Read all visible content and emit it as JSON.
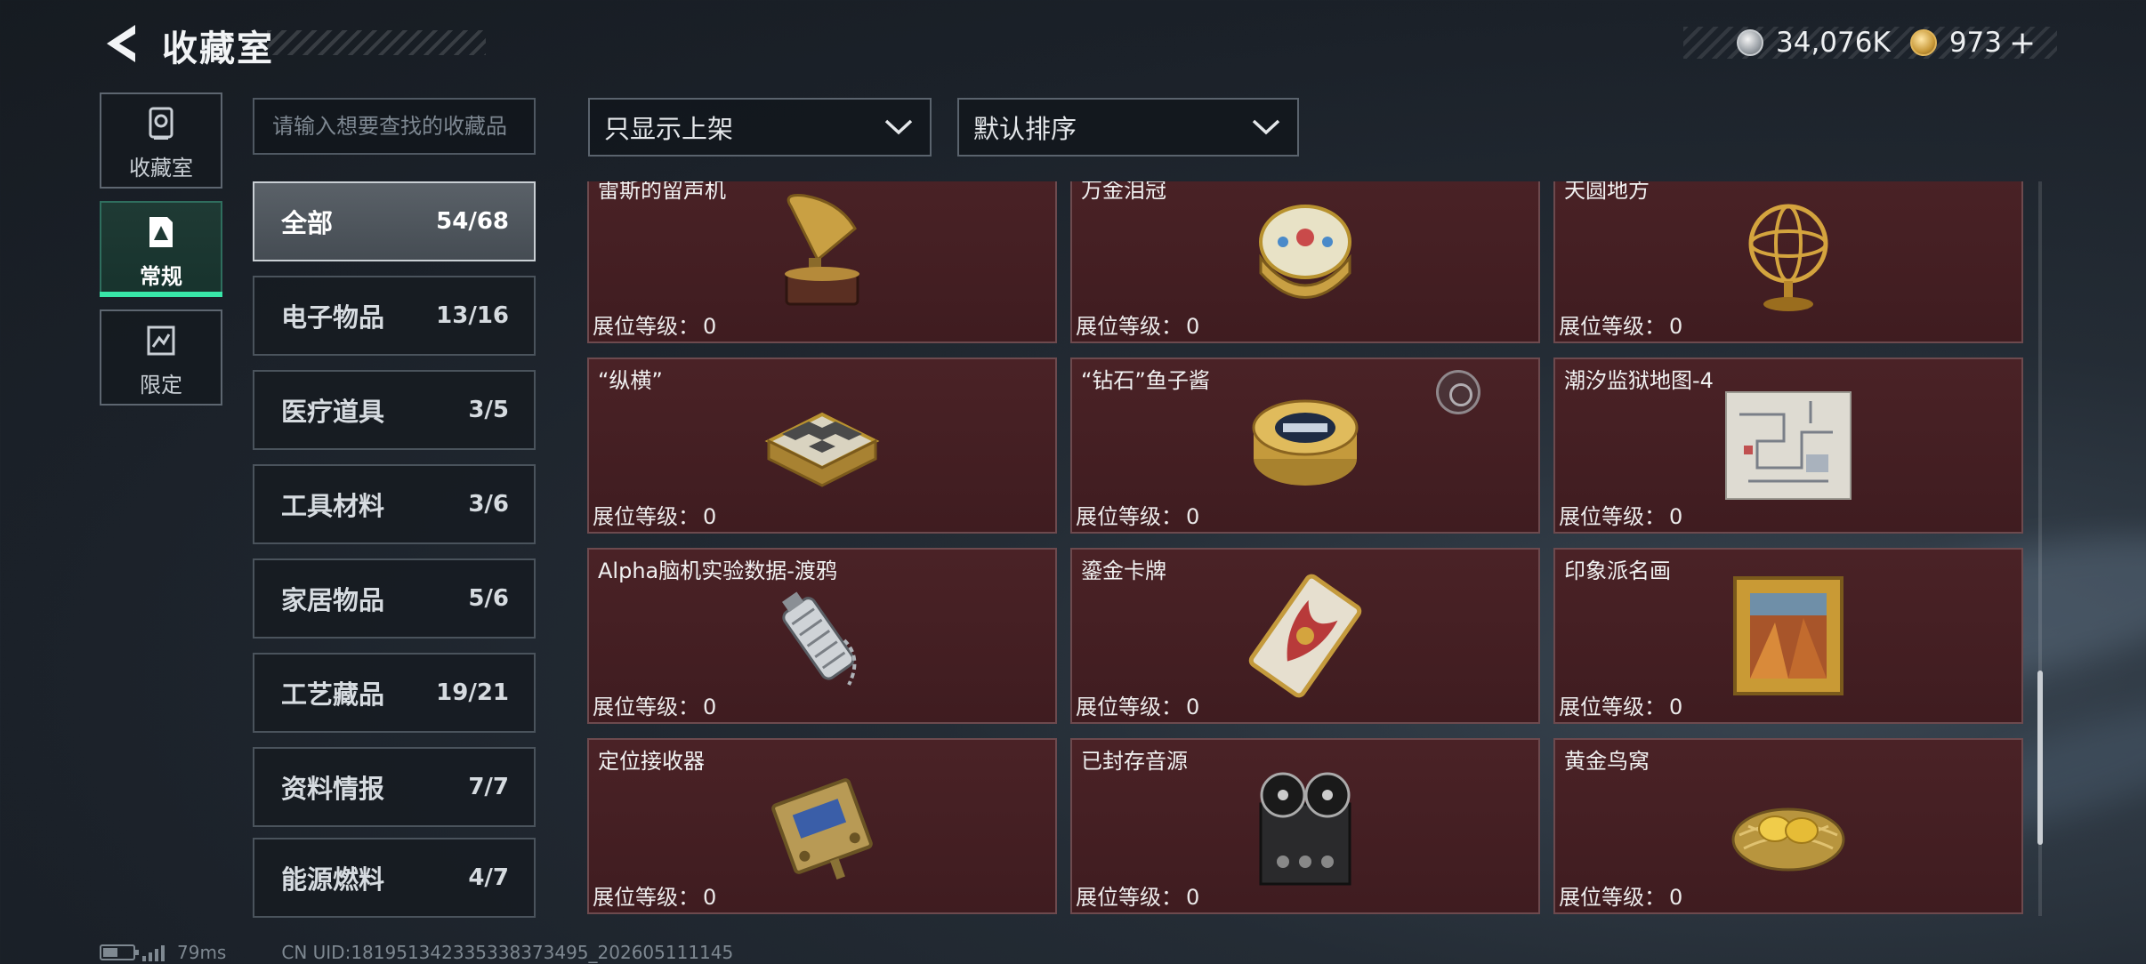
{
  "header": {
    "title": "收藏室",
    "currency_silver": "34,076K",
    "currency_gold": "973",
    "plus_label": "+"
  },
  "rail": [
    {
      "label": "收藏室",
      "icon": "vault-icon"
    },
    {
      "label": "常规",
      "icon": "collection-card-icon"
    },
    {
      "label": "限定",
      "icon": "limited-card-icon"
    }
  ],
  "search": {
    "placeholder": "请输入想要查找的收藏品"
  },
  "filters": {
    "display_filter": "只显示上架",
    "sort": "默认排序"
  },
  "categories": [
    {
      "name": "全部",
      "count": "54/68"
    },
    {
      "name": "电子物品",
      "count": "13/16"
    },
    {
      "name": "医疗道具",
      "count": "3/5"
    },
    {
      "name": "工具材料",
      "count": "3/6"
    },
    {
      "name": "家居物品",
      "count": "5/6"
    },
    {
      "name": "工艺藏品",
      "count": "19/21"
    },
    {
      "name": "资料情报",
      "count": "7/7"
    },
    {
      "name": "能源燃料",
      "count": "4/7"
    }
  ],
  "level_label": "展位等级：",
  "items": [
    {
      "name": "雷斯的留声机",
      "level": "0",
      "icon": "gramophone-icon"
    },
    {
      "name": "万金泪冠",
      "level": "0",
      "icon": "jeweled-egg-icon"
    },
    {
      "name": "天圆地方",
      "level": "0",
      "icon": "armillary-sphere-icon"
    },
    {
      "name": "“纵横”",
      "level": "0",
      "icon": "chessboard-icon"
    },
    {
      "name": "“钻石”鱼子酱",
      "level": "0",
      "icon": "caviar-tin-icon"
    },
    {
      "name": "潮汐监狱地图-4",
      "level": "0",
      "icon": "prison-map-icon"
    },
    {
      "name": "Alpha脑机实验数据-渡鸦",
      "level": "0",
      "icon": "data-canister-icon"
    },
    {
      "name": "鎏金卡牌",
      "level": "0",
      "icon": "gilded-card-icon"
    },
    {
      "name": "印象派名画",
      "level": "0",
      "icon": "framed-painting-icon"
    },
    {
      "name": "定位接收器",
      "level": "0",
      "icon": "locator-receiver-icon"
    },
    {
      "name": "已封存音源",
      "level": "0",
      "icon": "reel-recorder-icon"
    },
    {
      "name": "黄金鸟窝",
      "level": "0",
      "icon": "golden-nest-icon"
    }
  ],
  "footer": {
    "ping": "79ms",
    "uid": "CN UID:181951342335338373495_202605111145"
  }
}
